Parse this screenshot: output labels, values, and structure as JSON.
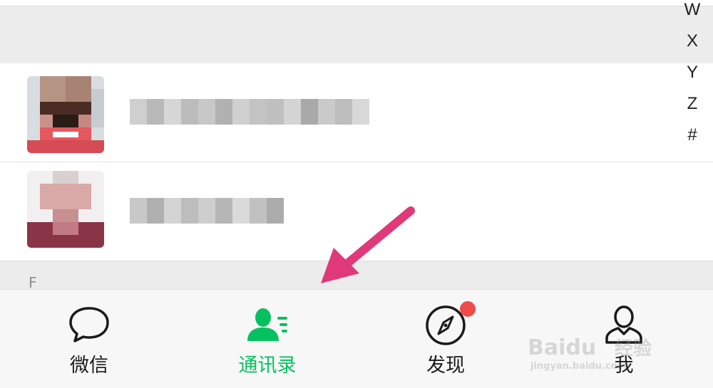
{
  "section_headers": [
    "",
    "F"
  ],
  "index_letters": [
    "W",
    "X",
    "Y",
    "Z",
    "#"
  ],
  "tabs": [
    {
      "label": "微信",
      "icon": "chat-bubble-icon",
      "active": false
    },
    {
      "label": "通讯录",
      "icon": "contacts-icon",
      "active": true
    },
    {
      "label": "发现",
      "icon": "compass-icon",
      "active": false,
      "badge": true
    },
    {
      "label": "我",
      "icon": "person-icon",
      "active": false
    }
  ],
  "watermark": {
    "brand": "Baidu",
    "suffix": "经验",
    "url": "jingyan.baidu.com"
  },
  "colors": {
    "accent": "#07c160",
    "badge": "#f04b4b",
    "arrow": "#e0397a",
    "header_bg": "#ececec",
    "tabbar_bg": "#f7f7f7"
  }
}
